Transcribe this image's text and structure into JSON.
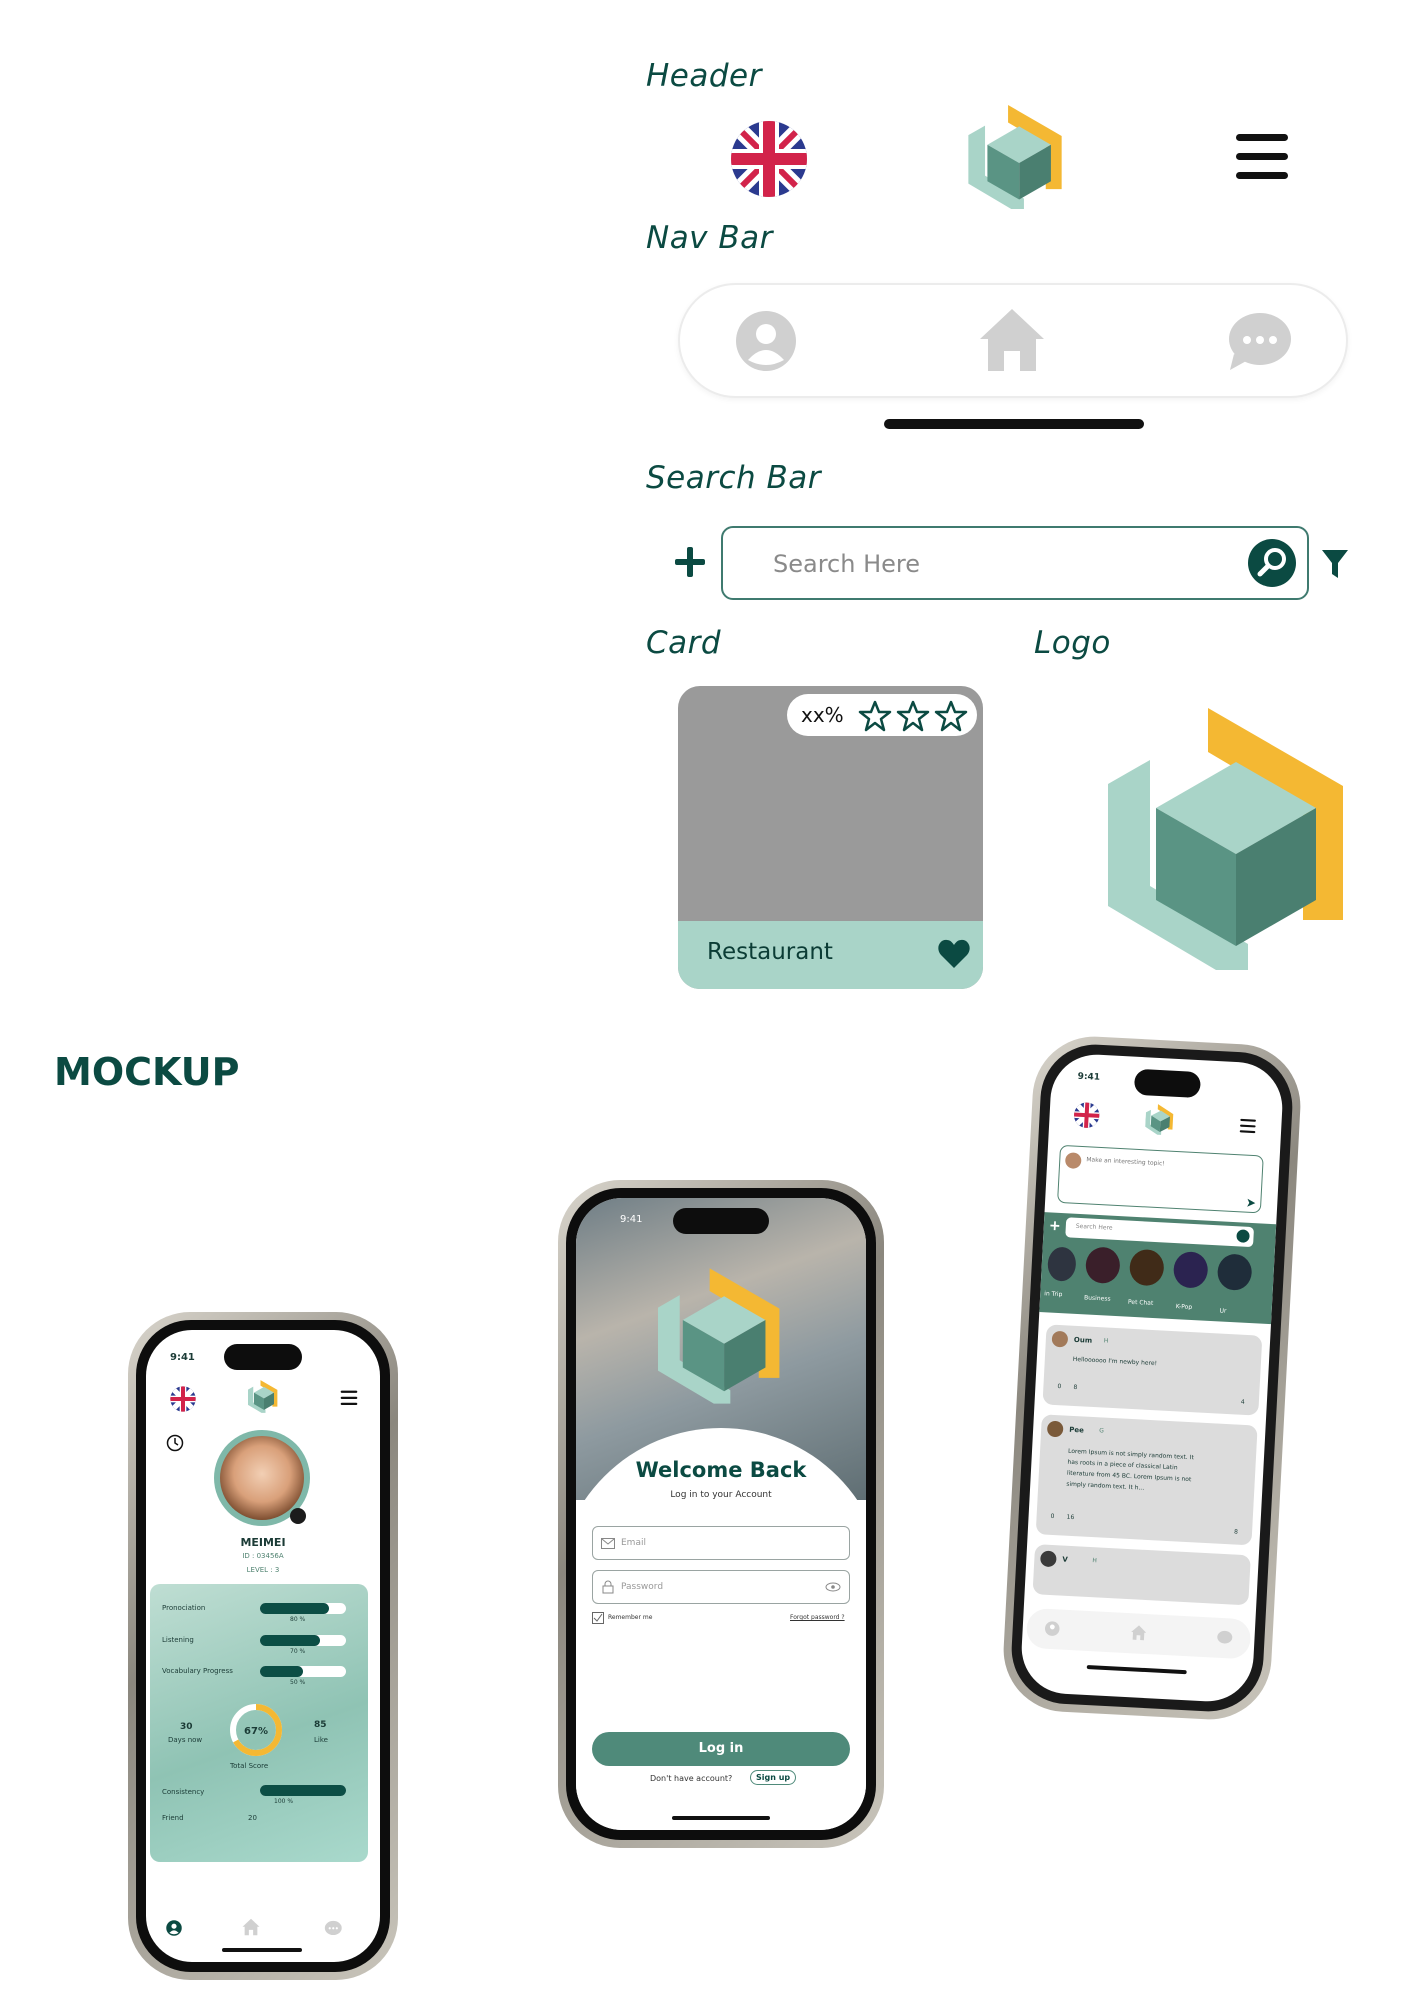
{
  "sections": {
    "header": "Header",
    "nav_bar": "Nav Bar",
    "search_bar": "Search Bar",
    "card": "Card",
    "logo": "Logo",
    "mockup": "MOCKUP"
  },
  "search": {
    "placeholder": "Search Here"
  },
  "card": {
    "rating": "xx%",
    "label": "Restaurant",
    "stars": 3
  },
  "colors": {
    "primary": "#0b4a42",
    "accent": "#f4b833",
    "mint": "#a9d4c8",
    "teal": "#4f8270",
    "card_gray": "#9a9a9a"
  },
  "icons": {
    "header": [
      "uk-flag-icon",
      "logo-icon",
      "hamburger-menu-icon"
    ],
    "navbar": [
      "profile-icon",
      "home-icon",
      "chat-icon"
    ],
    "search": [
      "plus-icon",
      "search-icon",
      "filter-icon"
    ]
  },
  "profile_phone": {
    "time": "9:41",
    "name": "MEIMEI",
    "id": "ID : 03456A",
    "level": "LEVEL : 3",
    "stats": [
      {
        "label": "Pronociation",
        "value": "80 %",
        "fraction": 0.8
      },
      {
        "label": "Listening",
        "value": "70 %",
        "fraction": 0.7
      },
      {
        "label": "Vocabulary Progress",
        "value": "50 %",
        "fraction": 0.5
      }
    ],
    "days": "30",
    "days_label": "Days now",
    "score": "67%",
    "score_fraction": 0.67,
    "likes": "85",
    "likes_label": "Like",
    "total_label": "Total Score",
    "consistency_label": "Consistency",
    "consistency_value": "100 %",
    "consistency_fraction": 1.0,
    "friend_label": "Friend",
    "friend_value": "20"
  },
  "login_phone": {
    "time": "9:41",
    "title": "Welcome Back",
    "subtitle": "Log in to your Account",
    "email_placeholder": "Email",
    "password_placeholder": "Password",
    "remember": "Remember me",
    "forgot": "Forgot password ?",
    "login_button": "Log in",
    "signup_prompt": "Don't have account?",
    "signup": "Sign up"
  },
  "feed_phone": {
    "time": "9:41",
    "topic_placeholder": "Make an interesting topic!",
    "search_placeholder": "Search Here",
    "categories": [
      "in Trip",
      "Business",
      "Pet Chat",
      "K-Pop",
      "Ur"
    ],
    "posts": [
      {
        "user": "Oum",
        "tag": "H",
        "text": "Helloooooo I'm newby here!",
        "likes": "0",
        "views": "8",
        "comments": "4"
      },
      {
        "user": "Pee",
        "tag": "G",
        "text": "Lorem Ipsum is not simply random text. It has roots in a piece of classical Latin literature from 45 BC. Lorem Ipsum is not simply random text. It h...",
        "likes": "0",
        "views": "16",
        "comments": "8"
      },
      {
        "user": "V",
        "tag": "H"
      }
    ]
  }
}
